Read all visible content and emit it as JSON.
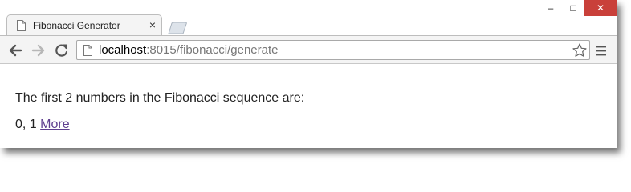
{
  "tab": {
    "title": "Fibonacci Generator",
    "close_glyph": "×"
  },
  "window_controls": {
    "minimize": "–",
    "maximize": "□",
    "close": "✕"
  },
  "address_bar": {
    "host": "localhost",
    "path": ":8015/fibonacci/generate"
  },
  "page": {
    "intro": "The first 2 numbers in the Fibonacci sequence are:",
    "sequence": "0, 1",
    "more_link": "More"
  },
  "colors": {
    "close_button": "#c9403a",
    "link_visited": "#5f3f8f",
    "toolbar": "#f4f4f4"
  },
  "icons": [
    "page-icon",
    "close-icon",
    "back-arrow-icon",
    "forward-arrow-icon",
    "reload-icon",
    "star-icon",
    "menu-icon"
  ]
}
